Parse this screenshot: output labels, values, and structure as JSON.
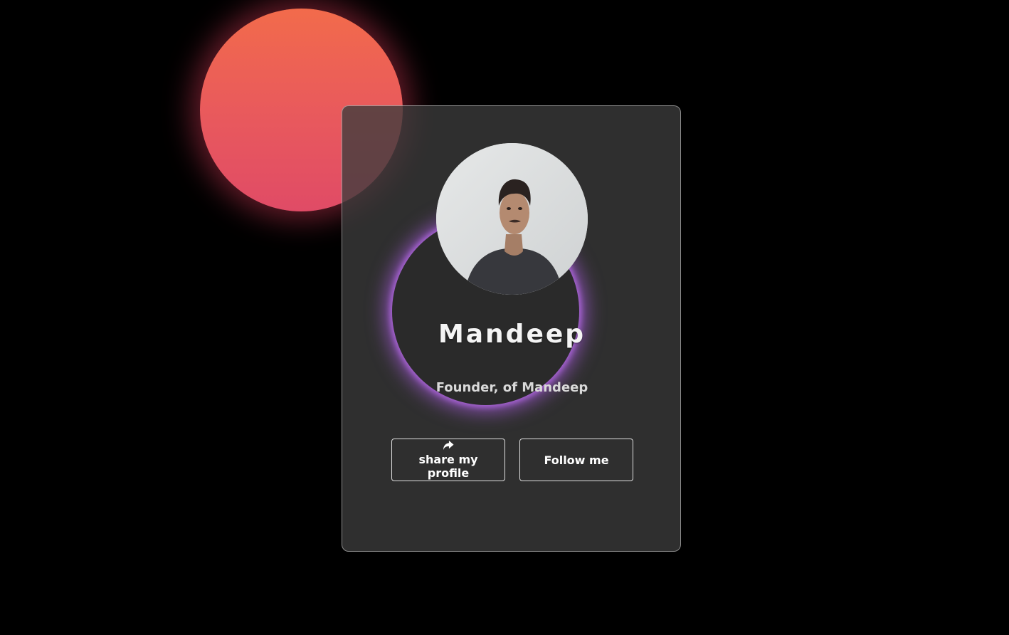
{
  "profile": {
    "name": "Mandeep",
    "role": "Founder, of Mandeep"
  },
  "actions": {
    "share_label": "share my profile",
    "share_icon": "share-arrow-icon",
    "follow_label": "Follow me"
  },
  "colors": {
    "background": "#000000",
    "blob_top": "#f26b4b",
    "blob_bottom": "#e04b66",
    "ring_glow": "#a964d6",
    "card": "#3c3c3c"
  }
}
